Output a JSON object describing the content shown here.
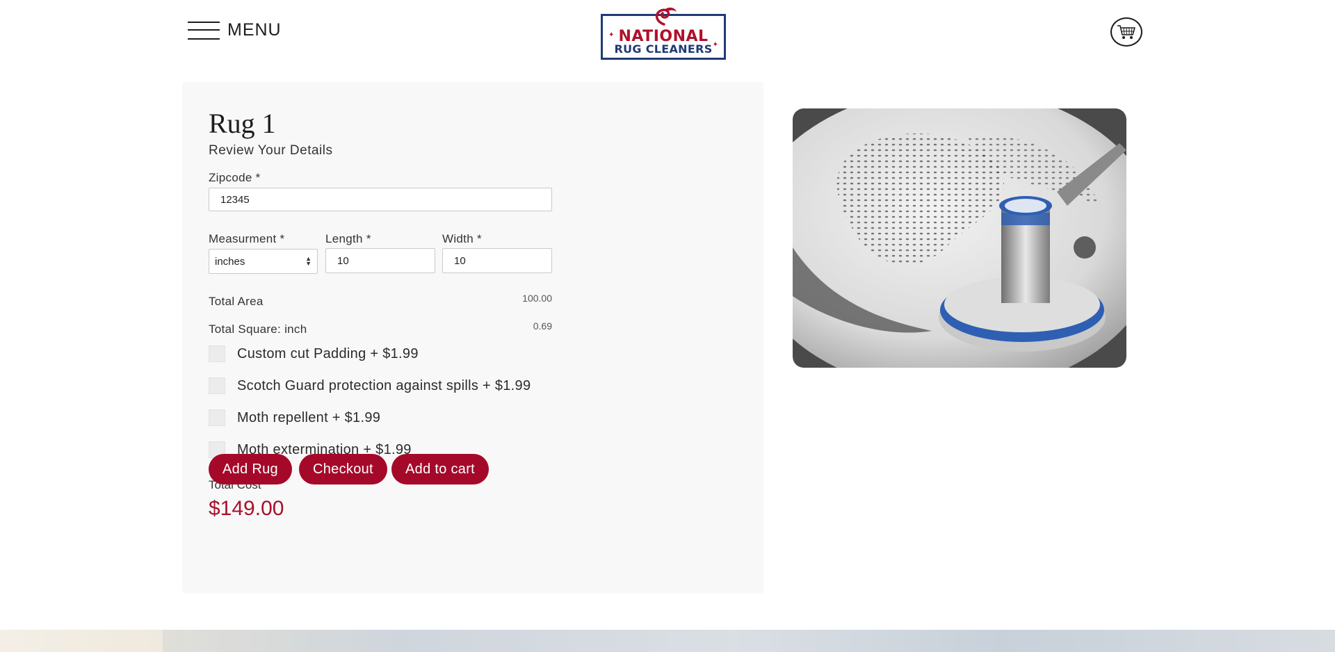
{
  "header": {
    "menu_label": "MENU",
    "logo": {
      "line1": "NATIONAL",
      "line2": "RUG CLEANERS"
    }
  },
  "form": {
    "rug_title": "Rug 1",
    "subtitle": "Review Your Details",
    "zipcode_label": "Zipcode *",
    "zipcode_value": "12345",
    "measurement_label": "Measurment *",
    "measurement_value": "inches",
    "length_label": "Length *",
    "length_value": "10",
    "width_label": "Width *",
    "width_value": "10",
    "total_area_label": "Total Area",
    "total_area_value": "100.00",
    "total_square_label": "Total Square: inch",
    "total_square_value": "0.69",
    "addons": [
      {
        "label": "Custom cut Padding + $1.99",
        "checked": false
      },
      {
        "label": "Scotch Guard protection against spills + $1.99",
        "checked": false
      },
      {
        "label": "Moth repellent + $1.99",
        "checked": false
      },
      {
        "label": "Moth extermination + $1.99",
        "checked": false
      }
    ],
    "total_cost_label": "Total Cost",
    "total_cost_value": "$149.00",
    "buttons": {
      "add_rug": "Add Rug",
      "checkout": "Checkout",
      "add_to_cart": "Add to cart"
    }
  },
  "colors": {
    "accent": "#a5092a",
    "navy": "#1f3a75",
    "card_bg": "#f8f8f8"
  },
  "icons": {
    "menu": "hamburger-icon",
    "cart": "cart-icon"
  }
}
